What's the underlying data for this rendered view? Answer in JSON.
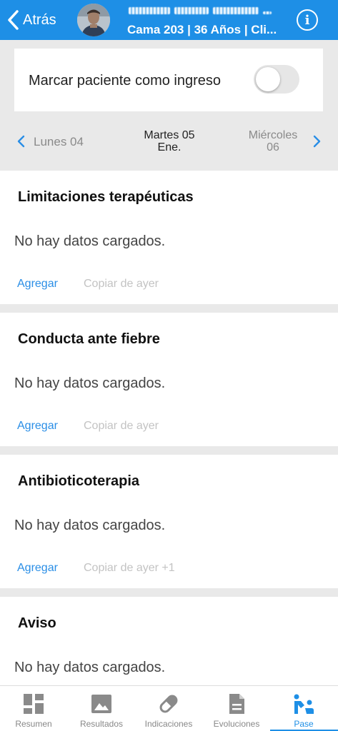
{
  "header": {
    "back_label": "Atrás",
    "patient_info": "Cama 203 | 36 Años | Cli..."
  },
  "admission": {
    "label": "Marcar paciente como ingreso",
    "checked": false
  },
  "date_nav": {
    "prev": "Lunes 04",
    "current_line1": "Martes 05",
    "current_line2": "Ene.",
    "next_line1": "Miércoles",
    "next_line2": "06"
  },
  "sections": [
    {
      "title": "Limitaciones terapéuticas",
      "empty": "No hay datos cargados.",
      "add": "Agregar",
      "copy": "Copiar de ayer"
    },
    {
      "title": "Conducta ante fiebre",
      "empty": "No hay datos cargados.",
      "add": "Agregar",
      "copy": "Copiar de ayer"
    },
    {
      "title": "Antibioticoterapia",
      "empty": "No hay datos cargados.",
      "add": "Agregar",
      "copy": "Copiar de ayer +1"
    },
    {
      "title": "Aviso",
      "empty": "No hay datos cargados."
    }
  ],
  "bottom_nav": {
    "tabs": [
      {
        "label": "Resumen",
        "icon": "dashboard-icon"
      },
      {
        "label": "Resultados",
        "icon": "image-icon"
      },
      {
        "label": "Indicaciones",
        "icon": "pill-icon"
      },
      {
        "label": "Evoluciones",
        "icon": "document-icon"
      },
      {
        "label": "Pase",
        "icon": "handoff-icon"
      }
    ],
    "active": "Pase"
  },
  "colors": {
    "accent": "#1e8fe6",
    "background": "#e9e9e9",
    "link": "#2a8ee6",
    "disabled_link": "#c3c3c3"
  }
}
